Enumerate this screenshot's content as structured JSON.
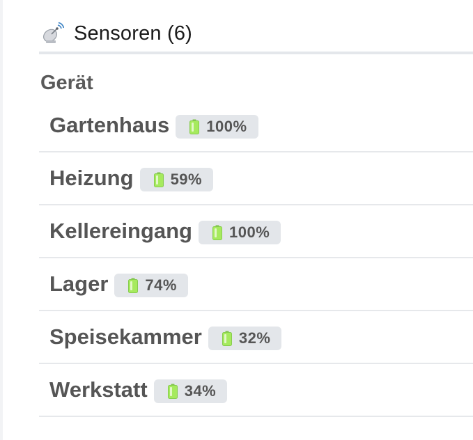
{
  "header": {
    "icon": "satellite-dish-icon",
    "title": "Sensoren (6)"
  },
  "table": {
    "column_heading": "Gerät",
    "rows": [
      {
        "name": "Gartenhaus",
        "battery": "100%",
        "battery_icon": "battery-icon"
      },
      {
        "name": "Heizung",
        "battery": "59%",
        "battery_icon": "battery-icon"
      },
      {
        "name": "Kellereingang",
        "battery": "100%",
        "battery_icon": "battery-icon"
      },
      {
        "name": "Lager",
        "battery": "74%",
        "battery_icon": "battery-icon"
      },
      {
        "name": "Speisekammer",
        "battery": "32%",
        "battery_icon": "battery-icon"
      },
      {
        "name": "Werkstatt",
        "battery": "34%",
        "battery_icon": "battery-icon"
      }
    ]
  },
  "colors": {
    "battery_green": "#9be55a",
    "badge_bg": "#e3e6ea",
    "text": "#555555"
  }
}
